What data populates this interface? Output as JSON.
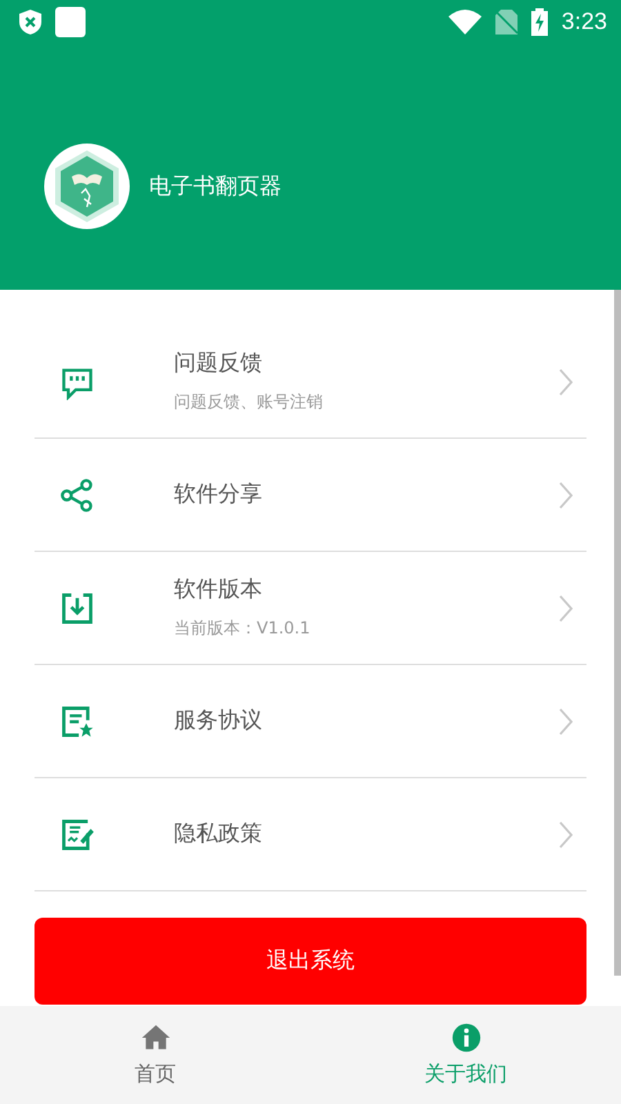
{
  "status_bar": {
    "time": "3:23"
  },
  "profile": {
    "app_name": "电子书翻页器"
  },
  "menu": [
    {
      "title": "问题反馈",
      "subtitle": "问题反馈、账号注销"
    },
    {
      "title": "软件分享"
    },
    {
      "title": "软件版本",
      "subtitle": "当前版本：V1.0.1"
    },
    {
      "title": "服务协议"
    },
    {
      "title": "隐私政策"
    }
  ],
  "logout_button": "退出系统",
  "tabs": [
    {
      "label": "首页",
      "selected": false
    },
    {
      "label": "关于我们",
      "selected": true
    }
  ]
}
